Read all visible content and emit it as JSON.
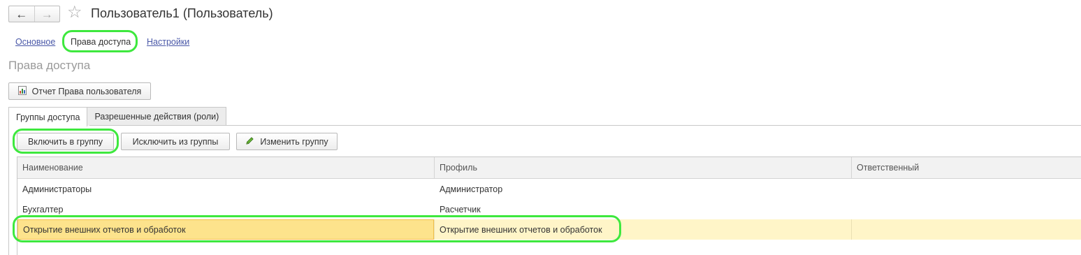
{
  "window": {
    "title": "Пользователь1 (Пользователь)",
    "nav_back_icon": "←",
    "nav_forward_icon": "→",
    "favorite_icon": "☆"
  },
  "section_links": [
    {
      "label": "Основное"
    },
    {
      "label": "Права доступа"
    },
    {
      "label": "Настройки"
    }
  ],
  "section_title": "Права доступа",
  "report_button": {
    "label": "Отчет Права пользователя"
  },
  "tabs": [
    {
      "label": "Группы доступа"
    },
    {
      "label": "Разрешенные действия (роли)"
    }
  ],
  "toolbar": {
    "include_label": "Включить в группу",
    "exclude_label": "Исключить из группы",
    "edit_label": "Изменить группу"
  },
  "table": {
    "columns": [
      "Наименование",
      "Профиль",
      "Ответственный"
    ],
    "rows": [
      {
        "name": "Администраторы",
        "profile": "Администратор",
        "responsible": ""
      },
      {
        "name": "Бухгалтер",
        "profile": "Расчетчик",
        "responsible": ""
      },
      {
        "name": "Открытие внешних отчетов и обработок",
        "profile": "Открытие внешних отчетов и обработок",
        "responsible": ""
      }
    ],
    "selected_row": 2
  },
  "colors": {
    "highlight": "#3ee83e",
    "selected_row": "#fff5c8",
    "selected_cell": "#fde38c",
    "link": "#4a58a8"
  }
}
